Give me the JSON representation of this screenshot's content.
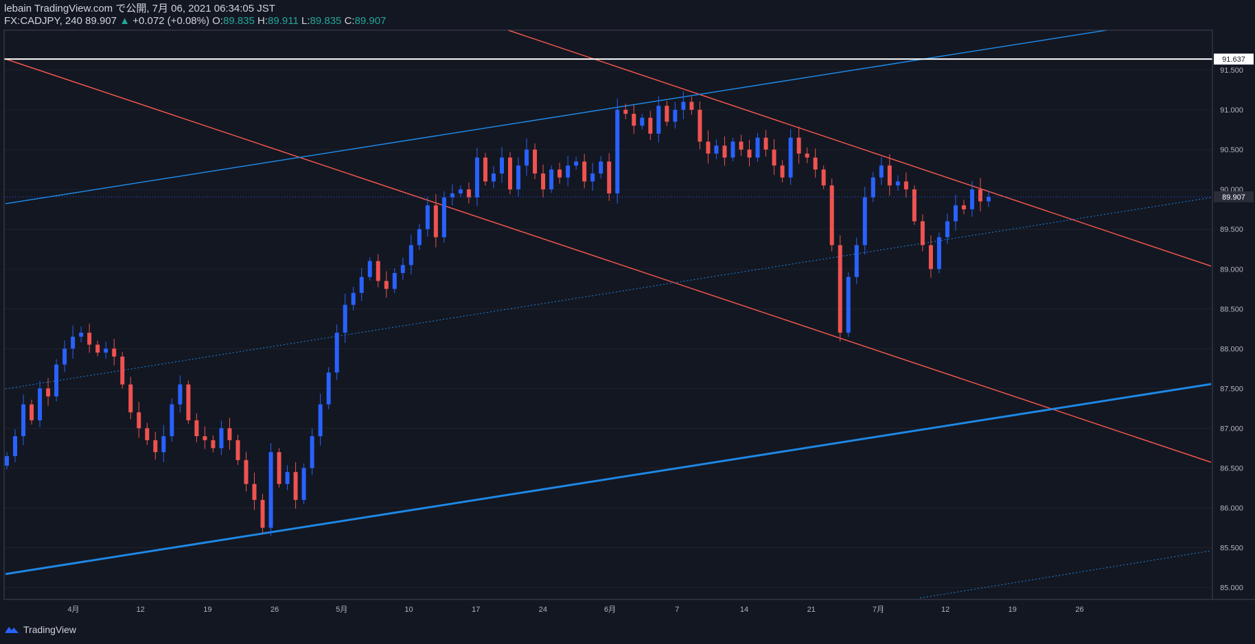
{
  "header": {
    "line1": "lebain TradingView.com で公開, 7月 06, 2021 06:34:05 JST",
    "symbol": "FX:CADJPY, 240",
    "last": "89.907",
    "arrow": "▲",
    "change": "+0.072 (+0.08%)",
    "o_label": "O:",
    "o_val": "89.835",
    "h_label": "H:",
    "h_val": "89.911",
    "l_label": "L:",
    "l_val": "89.835",
    "c_label": "C:",
    "c_val": "89.907"
  },
  "footer": {
    "brand": "TradingView"
  },
  "colors": {
    "bg": "#131722",
    "up": "#2962ff",
    "down": "#ef5350",
    "grid": "#2a2e39",
    "text": "#b2b5be",
    "blue_line": "#1e88e5",
    "red_line": "#f2564d"
  },
  "price_tags": {
    "current": "89.907",
    "level": "91.637"
  },
  "chart_data": {
    "type": "candlestick",
    "ylim": [
      84.85,
      92.0
    ],
    "y_ticks": [
      "91.500",
      "91.000",
      "90.500",
      "90.000",
      "89.500",
      "89.000",
      "88.500",
      "88.000",
      "87.500",
      "87.000",
      "86.500",
      "86.000",
      "85.500",
      "85.000"
    ],
    "x_ticks": [
      "4月",
      "12",
      "19",
      "26",
      "5月",
      "10",
      "17",
      "24",
      "6月",
      "7",
      "14",
      "21",
      "7月",
      "12",
      "19",
      "26"
    ],
    "horizontal_level": 91.637,
    "last_price": 89.907,
    "closes": [
      86.65,
      86.9,
      87.3,
      87.1,
      87.5,
      87.4,
      87.8,
      88.0,
      88.15,
      88.2,
      88.05,
      87.95,
      88.0,
      87.9,
      87.55,
      87.2,
      87.0,
      86.85,
      86.7,
      86.9,
      87.3,
      87.55,
      87.1,
      86.9,
      86.85,
      86.75,
      87.0,
      86.85,
      86.6,
      86.3,
      86.1,
      85.75,
      86.7,
      86.3,
      86.45,
      86.1,
      86.5,
      86.9,
      87.3,
      87.7,
      88.2,
      88.55,
      88.7,
      88.9,
      89.1,
      88.85,
      88.75,
      88.95,
      89.05,
      89.3,
      89.5,
      89.8,
      89.4,
      89.9,
      89.95,
      90.0,
      89.9,
      90.4,
      90.1,
      90.2,
      90.4,
      90.0,
      90.3,
      90.5,
      90.2,
      90.0,
      90.25,
      90.15,
      90.3,
      90.35,
      90.1,
      90.2,
      90.35,
      89.95,
      91.0,
      90.95,
      90.8,
      90.9,
      90.7,
      91.05,
      90.85,
      91.0,
      91.1,
      91.0,
      90.6,
      90.45,
      90.55,
      90.4,
      90.6,
      90.5,
      90.4,
      90.65,
      90.5,
      90.3,
      90.15,
      90.65,
      90.45,
      90.4,
      90.25,
      90.05,
      89.3,
      88.2,
      88.9,
      89.3,
      89.9,
      90.15,
      90.3,
      90.05,
      90.1,
      90.0,
      89.6,
      89.3,
      89.0,
      89.4,
      89.6,
      89.8,
      89.75,
      90.0,
      89.85,
      89.907
    ]
  }
}
